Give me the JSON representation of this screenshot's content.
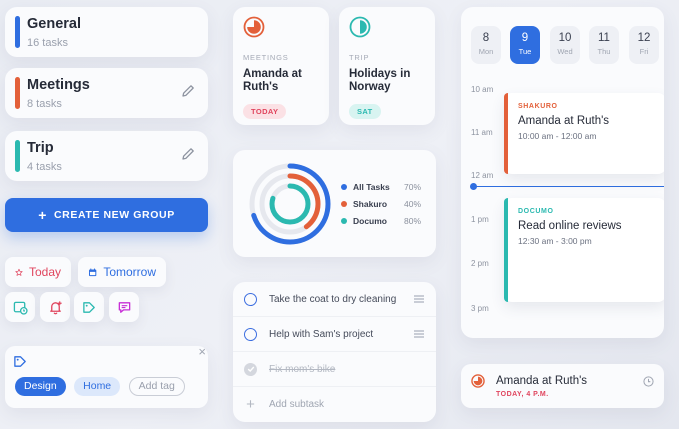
{
  "colors": {
    "blue": "#2f6ee0",
    "orange": "#e3603a",
    "teal": "#2bb9b0",
    "red": "#e0455e",
    "magenta": "#c72fd6"
  },
  "groups": [
    {
      "title": "General",
      "count": "16 tasks",
      "color": "#2f6ee0",
      "editable": false
    },
    {
      "title": "Meetings",
      "count": "8 tasks",
      "color": "#e3603a",
      "editable": true
    },
    {
      "title": "Trip",
      "count": "4 tasks",
      "color": "#2bb9b0",
      "editable": true
    }
  ],
  "create_group_label": "CREATE NEW GROUP",
  "quick": {
    "today_label": "Today",
    "tomorrow_label": "Tomorrow",
    "icons": [
      "calendar-clock-icon",
      "bell-plus-icon",
      "tag-arrow-icon",
      "comment-icon"
    ]
  },
  "tags": {
    "close": "×",
    "items": [
      {
        "label": "Design",
        "style": "selected"
      },
      {
        "label": "Home",
        "style": "light"
      },
      {
        "label": "Add tag",
        "style": "outline"
      }
    ]
  },
  "events": [
    {
      "category": "MEETINGS",
      "title": "Amanda at Ruth's",
      "badge": "TODAY",
      "icon": "orange-progress-icon"
    },
    {
      "category": "TRIP",
      "title": "Holidays in Norway",
      "badge": "SAT",
      "icon": "teal-progress-icon"
    }
  ],
  "progress": {
    "items": [
      {
        "name": "All Tasks",
        "percent": "70%",
        "value": 0.7,
        "color": "#2f6ee0"
      },
      {
        "name": "Shakuro",
        "percent": "40%",
        "value": 0.4,
        "color": "#e3603a"
      },
      {
        "name": "Documo",
        "percent": "80%",
        "value": 0.8,
        "color": "#2bb9b0"
      }
    ]
  },
  "subtasks": {
    "items": [
      {
        "text": "Take the coat to dry cleaning",
        "done": false
      },
      {
        "text": "Help with Sam's project",
        "done": false
      },
      {
        "text": "Fix mom's bike",
        "done": true
      }
    ],
    "add_label": "Add subtask"
  },
  "calendar": {
    "days": [
      {
        "num": "8",
        "label": "Mon",
        "active": false
      },
      {
        "num": "9",
        "label": "Tue",
        "active": true
      },
      {
        "num": "10",
        "label": "Wed",
        "active": false
      },
      {
        "num": "11",
        "label": "Thu",
        "active": false
      },
      {
        "num": "12",
        "label": "Fri",
        "active": false
      }
    ],
    "hours": [
      "10 am",
      "11 am",
      "12 am",
      "1 pm",
      "2 pm",
      "3 pm"
    ],
    "events": [
      {
        "category": "SHAKURO",
        "title": "Amanda at Ruth's",
        "time": "10:00 am - 12:00 am",
        "color": "#e3603a"
      },
      {
        "category": "DOCUMO",
        "title": "Read online reviews",
        "time": "12:30 am - 3:00 pm",
        "color": "#2bb9b0"
      }
    ]
  },
  "reminder": {
    "title": "Amanda at Ruth's",
    "when": "TODAY, 4 P.M."
  }
}
